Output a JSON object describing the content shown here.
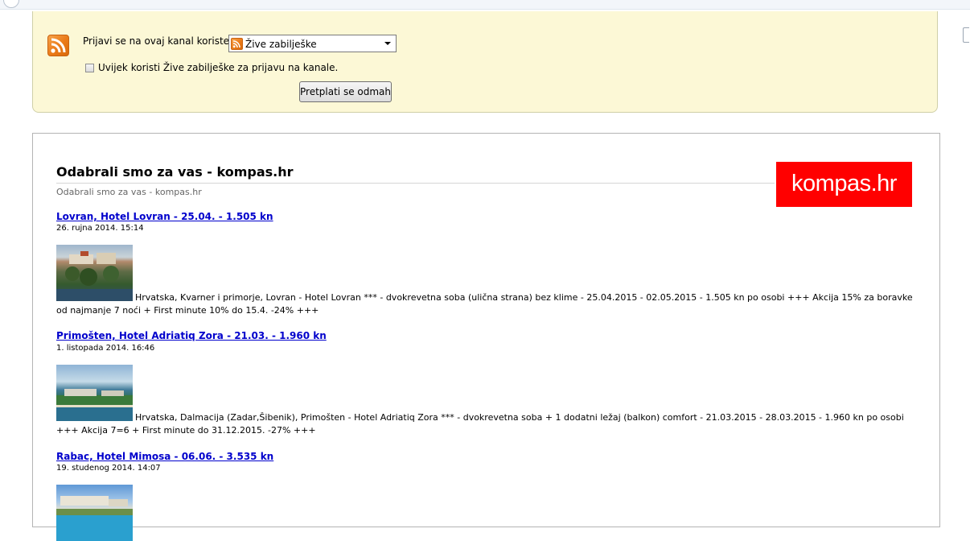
{
  "feed_box": {
    "subscribe_label": "Prijavi se na ovaj kanal koristeći",
    "reader_selected": "Žive zabilješke",
    "always_use_label": "Uvijek koristi Žive zabilješke za prijavu na kanale.",
    "subscribe_button": "Pretplati se odmah"
  },
  "feed": {
    "title": "Odabrali smo za vas - kompas.hr",
    "subtitle": "Odabrali smo za vas - kompas.hr",
    "logo_text": "kompas.hr",
    "logo_color": "#ff0000"
  },
  "entries": [
    {
      "title": "Lovran, Hotel Lovran - 25.04. - 1.505 kn",
      "date": "26. rujna 2014. 15:14",
      "description": "Hrvatska, Kvarner i primorje, Lovran - Hotel Lovran *** - dvokrevetna soba (ulična strana) bez klime - 25.04.2015 - 02.05.2015 - 1.505 kn po osobi +++ Akcija 15% za boravke od najmanje 7 noći + First minute 10% do 15.4. -24% +++"
    },
    {
      "title": "Primošten, Hotel Adriatiq Zora - 21.03. - 1.960 kn",
      "date": "1. listopada 2014. 16:46",
      "description": "Hrvatska, Dalmacija (Zadar,Šibenik), Primošten - Hotel Adriatiq Zora *** - dvokrevetna soba + 1 dodatni ležaj (balkon) comfort - 21.03.2015 - 28.03.2015 - 1.960 kn po osobi +++ Akcija 7=6 + First minute do 31.12.2015. -27% +++"
    },
    {
      "title": "Rabac, Hotel Mimosa - 06.06. - 3.535 kn",
      "date": "19. studenog 2014. 14:07"
    }
  ]
}
